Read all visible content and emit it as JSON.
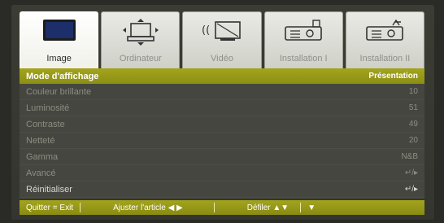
{
  "tabs": [
    {
      "label": "Image",
      "icon": "monitor-icon",
      "active": true
    },
    {
      "label": "Ordinateur",
      "icon": "computer-icon",
      "active": false
    },
    {
      "label": "Vidéo",
      "icon": "video-icon",
      "active": false
    },
    {
      "label": "Installation I",
      "icon": "projector-icon",
      "active": false
    },
    {
      "label": "Installation II",
      "icon": "projector-settings-icon",
      "active": false
    }
  ],
  "menu": {
    "header": {
      "label": "Mode d'affichage",
      "value": "Présentation"
    },
    "rows": [
      {
        "label": "Couleur brillante",
        "value": "10"
      },
      {
        "label": "Luminosité",
        "value": "51"
      },
      {
        "label": "Contraste",
        "value": "49"
      },
      {
        "label": "Netteté",
        "value": "20"
      },
      {
        "label": "Gamma",
        "value": "N&B"
      },
      {
        "label": "Avancé",
        "value": "↵/▸"
      },
      {
        "label": "Réinitialiser",
        "value": "↵/▸"
      }
    ]
  },
  "footer": {
    "quit": "Quitter = Exit",
    "adjust": "Ajuster l'article ◀ ▶",
    "scroll": "Défiler ▲▼",
    "extra": "▼"
  },
  "colors": {
    "accent": "#9c9e18",
    "panel": "#45463f"
  }
}
